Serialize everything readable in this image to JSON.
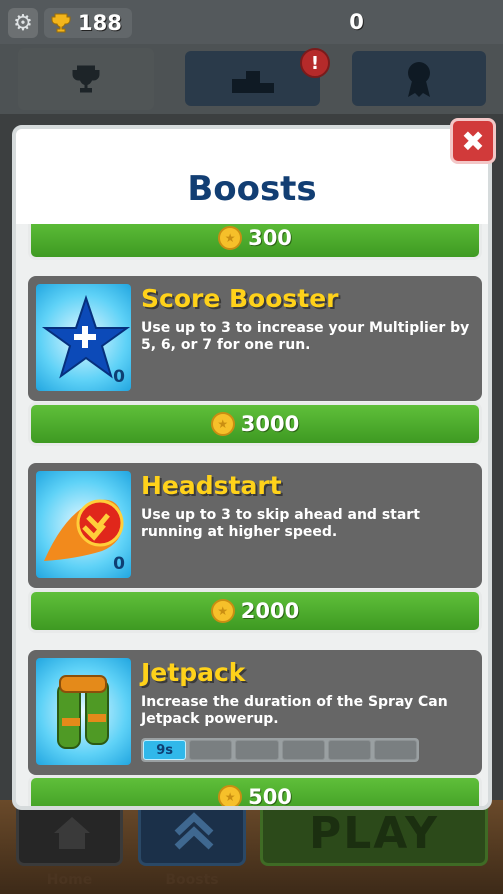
{
  "hud": {
    "trophies": "188",
    "score": "0"
  },
  "nav": {
    "home_label": "Home",
    "boosts_label": "Boosts",
    "play_label": "PLAY"
  },
  "alert_badge": "!",
  "dialog": {
    "title": "Boosts",
    "close_glyph": "✖"
  },
  "boosts": {
    "top_price": "300",
    "items": [
      {
        "title": "Score Booster",
        "description": "Use up to 3 to increase your Multiplier by 5, 6, or 7 for one run.",
        "owned": "0",
        "price": "3000"
      },
      {
        "title": "Headstart",
        "description": "Use up to 3 to skip ahead and start running at higher speed.",
        "owned": "0",
        "price": "2000"
      },
      {
        "title": "Jetpack",
        "description": "Increase the duration of the Spray Can Jetpack powerup.",
        "duration_label": "9s",
        "upgrade_level": 1,
        "upgrade_max": 6,
        "price": "500"
      }
    ]
  },
  "colors": {
    "title_blue": "#123e73",
    "card_title_yellow": "#ffd21a",
    "buy_green": "#4caf2b",
    "close_red": "#d13a3a"
  }
}
